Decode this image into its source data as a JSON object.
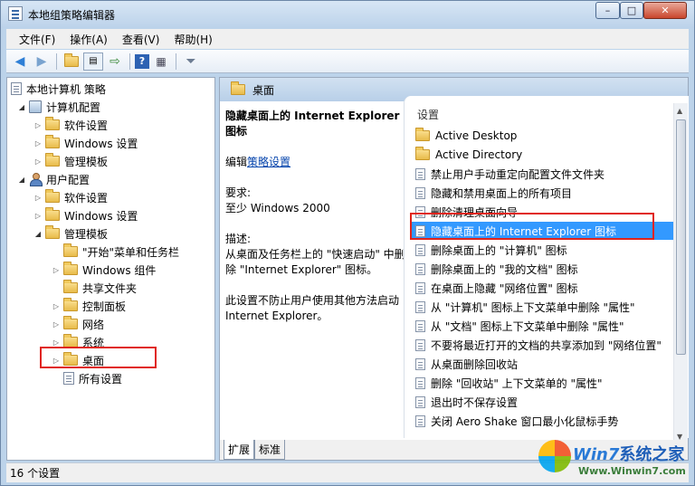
{
  "window": {
    "title": "本地组策略编辑器",
    "controls": {
      "minimize": "–",
      "maximize": "□",
      "close": "✕"
    }
  },
  "menu": [
    "文件(F)",
    "操作(A)",
    "查看(V)",
    "帮助(H)"
  ],
  "toolbar": {
    "icons": [
      "back-icon",
      "forward-icon",
      "up-folder-icon",
      "show-hide-tree-icon",
      "export-list-icon",
      "help-icon",
      "properties-icon",
      "filter-icon"
    ]
  },
  "tree": {
    "root": "本地计算机 策略",
    "computer_config": "计算机配置",
    "c_software": "软件设置",
    "c_windows": "Windows 设置",
    "c_admin": "管理模板",
    "user_config": "用户配置",
    "u_software": "软件设置",
    "u_windows": "Windows 设置",
    "u_admin": "管理模板",
    "start_menu": "\"开始\"菜单和任务栏",
    "win_components": "Windows 组件",
    "shared_folders": "共享文件夹",
    "control_panel": "控制面板",
    "network": "网络",
    "system": "系统",
    "desktop": "桌面",
    "all_settings": "所有设置"
  },
  "right": {
    "header": "桌面",
    "desc_title": "隐藏桌面上的 Internet Explorer 图标",
    "edit_prefix": "编辑",
    "edit_link": "策略设置",
    "req_label": "要求:",
    "req_value": "至少 Windows 2000",
    "desc_label": "描述:",
    "desc_text": "从桌面及任务栏上的 \"快速启动\" 中删除 \"Internet Explorer\" 图标。",
    "note": "此设置不防止用户使用其他方法启动 Internet Explorer。",
    "col_header": "设置",
    "items": [
      "Active Desktop",
      "Active Directory",
      "禁止用户手动重定向配置文件文件夹",
      "隐藏和禁用桌面上的所有项目",
      "删除清理桌面向导",
      "隐藏桌面上的 Internet Explorer 图标",
      "删除桌面上的 \"计算机\" 图标",
      "删除桌面上的 \"我的文档\" 图标",
      "在桌面上隐藏 \"网络位置\" 图标",
      "从 \"计算机\" 图标上下文菜单中删除 \"属性\"",
      "从 \"文档\" 图标上下文菜单中删除 \"属性\"",
      "不要将最近打开的文档的共享添加到 \"网络位置\"",
      "从桌面删除回收站",
      "删除 \"回收站\" 上下文菜单的 \"属性\"",
      "退出时不保存设置",
      "关闭 Aero Shake 窗口最小化鼠标手势"
    ],
    "tabs": [
      "扩展",
      "标准"
    ]
  },
  "status": "16 个设置",
  "watermark": {
    "brand_win": "Win7",
    "brand_rest": "系统之家",
    "url": "Www.Winwin7.com"
  }
}
